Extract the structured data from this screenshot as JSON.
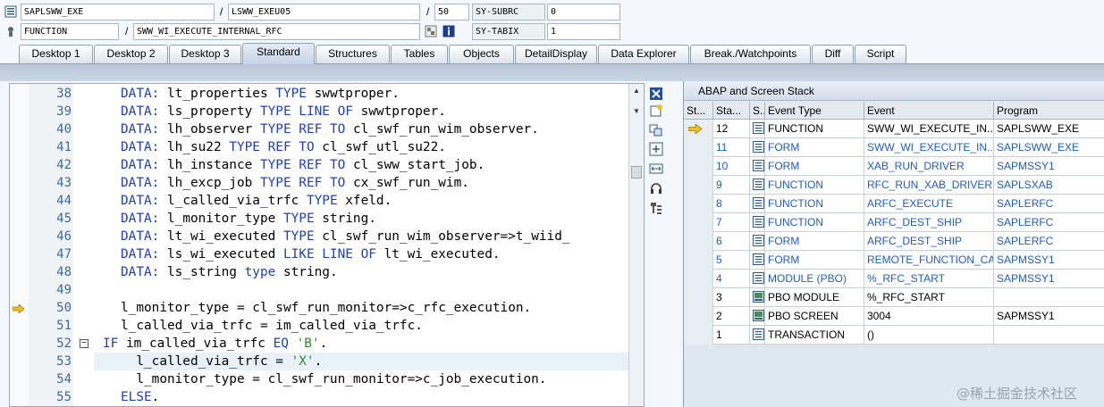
{
  "info": {
    "row1": {
      "program": "SAPLSWW_EXE",
      "sep": "/",
      "include": "LSWW_EXEU05",
      "sep2": "/",
      "line": "50",
      "var_label": "SY-SUBRC",
      "var_value": "0"
    },
    "row2": {
      "event_type": "FUNCTION",
      "sep": "/",
      "event": "SWW_WI_EXECUTE_INTERNAL_RFC",
      "var_label": "SY-TABIX",
      "var_value": "1"
    }
  },
  "tabs": [
    {
      "label": "Desktop 1"
    },
    {
      "label": "Desktop 2"
    },
    {
      "label": "Desktop 3"
    },
    {
      "label": "Standard"
    },
    {
      "label": "Structures"
    },
    {
      "label": "Tables"
    },
    {
      "label": "Objects"
    },
    {
      "label": "DetailDisplay"
    },
    {
      "label": "Data Explorer"
    },
    {
      "label": "Break./Watchpoints"
    },
    {
      "label": "Diff"
    },
    {
      "label": "Script"
    }
  ],
  "active_tab": "Standard",
  "editor": {
    "lines": [
      {
        "num": "38",
        "code": [
          [
            "kw",
            "DATA:"
          ],
          [
            "t",
            " lt_properties "
          ],
          [
            "kw",
            "TYPE"
          ],
          [
            "t",
            " swwtproper."
          ]
        ]
      },
      {
        "num": "39",
        "code": [
          [
            "kw",
            "DATA:"
          ],
          [
            "t",
            " ls_property "
          ],
          [
            "kw",
            "TYPE LINE OF"
          ],
          [
            "t",
            " swwtproper."
          ]
        ]
      },
      {
        "num": "40",
        "code": [
          [
            "kw",
            "DATA:"
          ],
          [
            "t",
            " lh_observer "
          ],
          [
            "kw",
            "TYPE REF TO"
          ],
          [
            "t",
            " cl_swf_run_wim_observer."
          ]
        ]
      },
      {
        "num": "41",
        "code": [
          [
            "kw",
            "DATA:"
          ],
          [
            "t",
            " lh_su22 "
          ],
          [
            "kw",
            "TYPE REF TO"
          ],
          [
            "t",
            " cl_swf_utl_su22."
          ]
        ]
      },
      {
        "num": "42",
        "code": [
          [
            "kw",
            "DATA:"
          ],
          [
            "t",
            " lh_instance "
          ],
          [
            "kw",
            "TYPE REF TO"
          ],
          [
            "t",
            " cl_sww_start_job."
          ]
        ]
      },
      {
        "num": "43",
        "code": [
          [
            "kw",
            "DATA:"
          ],
          [
            "t",
            " lh_excp_job "
          ],
          [
            "kw",
            "TYPE REF TO"
          ],
          [
            "t",
            " cx_swf_run_wim."
          ]
        ]
      },
      {
        "num": "44",
        "code": [
          [
            "kw",
            "DATA:"
          ],
          [
            "t",
            " l_called_via_trfc "
          ],
          [
            "kw",
            "TYPE"
          ],
          [
            "t",
            " xfeld."
          ]
        ]
      },
      {
        "num": "45",
        "code": [
          [
            "kw",
            "DATA:"
          ],
          [
            "t",
            " l_monitor_type "
          ],
          [
            "kw",
            "TYPE"
          ],
          [
            "t",
            " string."
          ]
        ]
      },
      {
        "num": "46",
        "code": [
          [
            "kw",
            "DATA:"
          ],
          [
            "t",
            " lt_wi_executed "
          ],
          [
            "kw",
            "TYPE"
          ],
          [
            "t",
            " cl_swf_run_wim_observer=>t_wiid_"
          ]
        ]
      },
      {
        "num": "47",
        "code": [
          [
            "kw",
            "DATA:"
          ],
          [
            "t",
            " ls_wi_executed "
          ],
          [
            "kw",
            "LIKE LINE OF"
          ],
          [
            "t",
            " lt_wi_executed."
          ]
        ]
      },
      {
        "num": "48",
        "code": [
          [
            "kw",
            "DATA:"
          ],
          [
            "t",
            " ls_string "
          ],
          [
            "kw",
            "type"
          ],
          [
            "t",
            " string."
          ]
        ]
      },
      {
        "num": "49",
        "code": []
      },
      {
        "num": "50",
        "code": [
          [
            "t",
            "l_monitor_type = cl_swf_run_monitor=>c_rfc_execution."
          ]
        ]
      },
      {
        "num": "51",
        "code": [
          [
            "t",
            "l_called_via_trfc = im_called_via_trfc."
          ]
        ]
      },
      {
        "num": "52",
        "code": [
          [
            "kw",
            "IF"
          ],
          [
            "t",
            " im_called_via_trfc "
          ],
          [
            "kw",
            "EQ"
          ],
          [
            "t",
            " "
          ],
          [
            "str",
            "'B'"
          ],
          [
            "t",
            "."
          ]
        ]
      },
      {
        "num": "53",
        "code": [
          [
            "t",
            "  l_called_via_trfc = "
          ],
          [
            "str",
            "'X'"
          ],
          [
            "t",
            "."
          ]
        ]
      },
      {
        "num": "54",
        "code": [
          [
            "t",
            "  l_monitor_type = cl_swf_run_monitor=>c_job_execution."
          ]
        ]
      },
      {
        "num": "55",
        "code": [
          [
            "kw",
            "ELSE"
          ],
          [
            "t",
            "."
          ]
        ]
      }
    ],
    "current_line": "50"
  },
  "stack": {
    "title": "ABAP and Screen Stack",
    "columns": [
      "St...",
      "Sta...",
      "S...",
      "Event Type",
      "Event",
      "Program"
    ],
    "rows": [
      {
        "level": "12",
        "type_icon": "function-icon",
        "event_type": "FUNCTION",
        "event": "SWW_WI_EXECUTE_IN...",
        "program": "SAPLSWW_EXE",
        "current": true,
        "link": false
      },
      {
        "level": "11",
        "type_icon": "function-icon",
        "event_type": "FORM",
        "event": "SWW_WI_EXECUTE_IN...",
        "program": "SAPLSWW_EXE",
        "current": false,
        "link": true
      },
      {
        "level": "10",
        "type_icon": "function-icon",
        "event_type": "FORM",
        "event": "XAB_RUN_DRIVER",
        "program": "SAPMSSY1",
        "current": false,
        "link": true
      },
      {
        "level": "9",
        "type_icon": "function-icon",
        "event_type": "FUNCTION",
        "event": "RFC_RUN_XAB_DRIVER",
        "program": "SAPLSXAB",
        "current": false,
        "link": true
      },
      {
        "level": "8",
        "type_icon": "function-icon",
        "event_type": "FUNCTION",
        "event": "ARFC_EXECUTE",
        "program": "SAPLERFC",
        "current": false,
        "link": true
      },
      {
        "level": "7",
        "type_icon": "function-icon",
        "event_type": "FUNCTION",
        "event": "ARFC_DEST_SHIP",
        "program": "SAPLERFC",
        "current": false,
        "link": true
      },
      {
        "level": "6",
        "type_icon": "function-icon",
        "event_type": "FORM",
        "event": "ARFC_DEST_SHIP",
        "program": "SAPLERFC",
        "current": false,
        "link": true
      },
      {
        "level": "5",
        "type_icon": "function-icon",
        "event_type": "FORM",
        "event": "REMOTE_FUNCTION_CA...",
        "program": "SAPMSSY1",
        "current": false,
        "link": true
      },
      {
        "level": "4",
        "type_icon": "function-icon",
        "event_type": "MODULE (PBO)",
        "event": "%_RFC_START",
        "program": "SAPMSSY1",
        "current": false,
        "link": true
      },
      {
        "level": "3",
        "type_icon": "screen-icon",
        "event_type": "PBO MODULE",
        "event": "%_RFC_START",
        "program": "",
        "current": false,
        "link": false
      },
      {
        "level": "2",
        "type_icon": "screen-icon",
        "event_type": "PBO SCREEN",
        "event": "3004",
        "program": "SAPMSSY1",
        "current": false,
        "link": false
      },
      {
        "level": "1",
        "type_icon": "function-icon",
        "event_type": "TRANSACTION",
        "event": "()",
        "program": "",
        "current": false,
        "link": false
      }
    ]
  },
  "watermark": "@稀土掘金技术社区",
  "colors": {
    "keyword": "#1c3dd0",
    "string": "#2a8a2a",
    "link": "#1c5bcc",
    "arrow": "#f0c020"
  }
}
